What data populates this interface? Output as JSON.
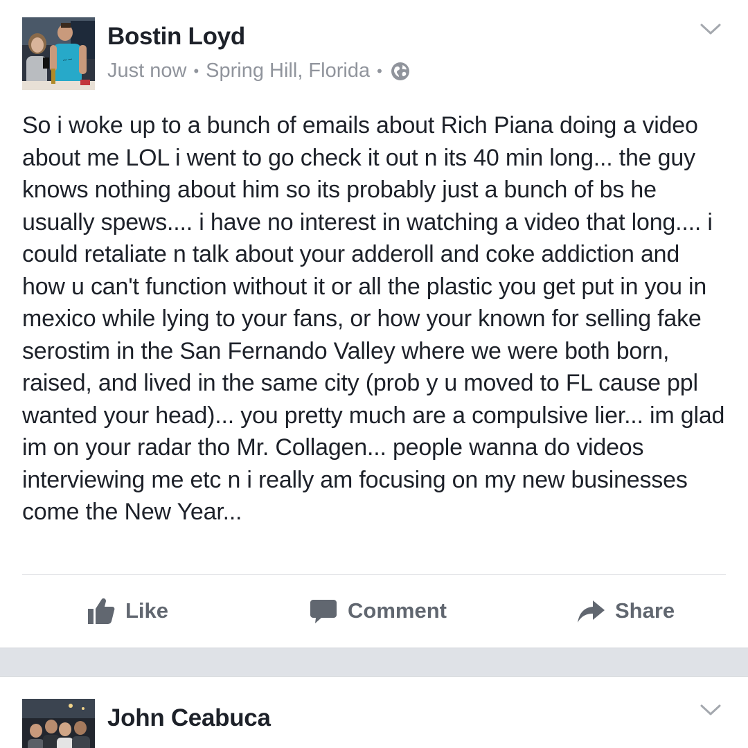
{
  "posts": [
    {
      "author": "Bostin Loyd",
      "time": "Just now",
      "location": "Spring Hill, Florida",
      "separator": "•",
      "privacy_icon": "globe-icon",
      "menu_icon": "chevron-down-icon",
      "text": "So i woke up to a bunch of emails about Rich Piana doing a video about me LOL i went to go check it out n its 40 min long... the guy knows nothing about him so its probably just a bunch of bs he usually spews.... i have no interest in watching a video that long.... i could retaliate n talk about your adderoll and coke addiction and how u can't function without it or all the plastic you get put in you in mexico while lying to your fans, or how your known for selling fake serostim in the San Fernando Valley where we were both born, raised, and lived in the same city (prob y u moved to FL cause ppl wanted your head)... you pretty much are a compulsive lier... im glad im on your radar tho Mr. Collagen... people wanna do videos interviewing me etc n i really am focusing on my new businesses come the New Year...",
      "actions": {
        "like": "Like",
        "comment": "Comment",
        "share": "Share"
      }
    },
    {
      "author": "John Ceabuca",
      "menu_icon": "chevron-down-icon"
    }
  ],
  "colors": {
    "text_primary": "#1d2129",
    "text_secondary": "#90949c",
    "action_text": "#616770",
    "feed_background": "#dfe2e7",
    "divider": "#e5e6e9"
  }
}
